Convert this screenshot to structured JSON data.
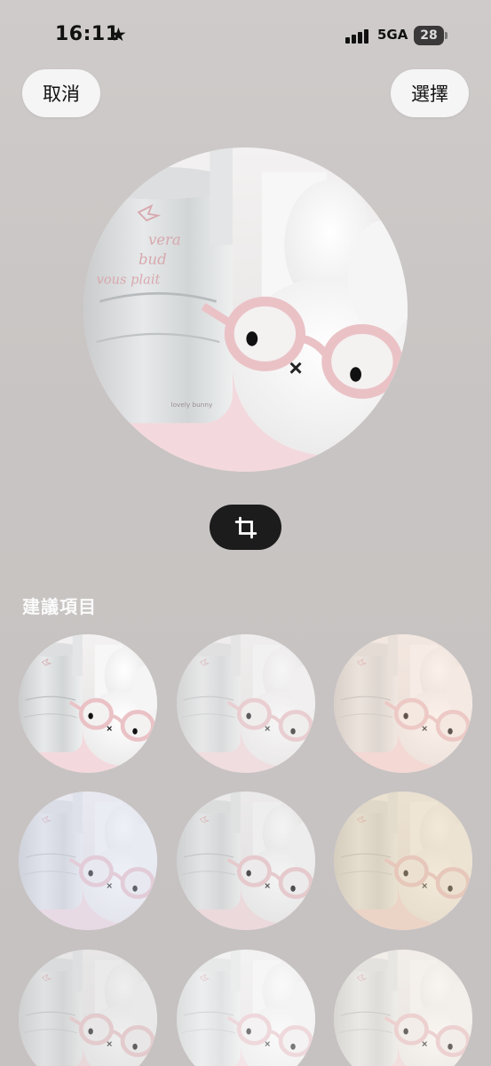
{
  "status_bar": {
    "time": "16:11",
    "star_icon": "star-icon",
    "network": "5GA",
    "battery": "28"
  },
  "nav": {
    "cancel_label": "取消",
    "choose_label": "選擇"
  },
  "main_photo": {
    "bottle_text_1": "vera",
    "bottle_text_2": "bud",
    "bottle_text_3": "vous plait"
  },
  "crop": {
    "icon": "crop-icon"
  },
  "suggestions": {
    "title": "建議項目",
    "filters": [
      {
        "name": "filter-original",
        "tint": "#ffffff",
        "opacity": 0
      },
      {
        "name": "filter-muted",
        "tint": "#e8e6e6",
        "opacity": 0.35
      },
      {
        "name": "filter-warm",
        "tint": "#f4d7c4",
        "opacity": 0.35
      },
      {
        "name": "filter-cool",
        "tint": "#d8dcef",
        "opacity": 0.4
      },
      {
        "name": "filter-silver",
        "tint": "#dcdada",
        "opacity": 0.3
      },
      {
        "name": "filter-sepia",
        "tint": "#e3cfaa",
        "opacity": 0.45
      },
      {
        "name": "filter-mono",
        "tint": "#d6d6d6",
        "opacity": 0.4
      },
      {
        "name": "filter-bright",
        "tint": "#f3f3f3",
        "opacity": 0.45
      },
      {
        "name": "filter-cream",
        "tint": "#efe8de",
        "opacity": 0.4
      }
    ]
  },
  "colors": {
    "background": "#c9c5c4",
    "button_bg": "#f6f5f5",
    "crop_bg": "#1c1c1c",
    "pink_glasses": "#eac2c6"
  }
}
